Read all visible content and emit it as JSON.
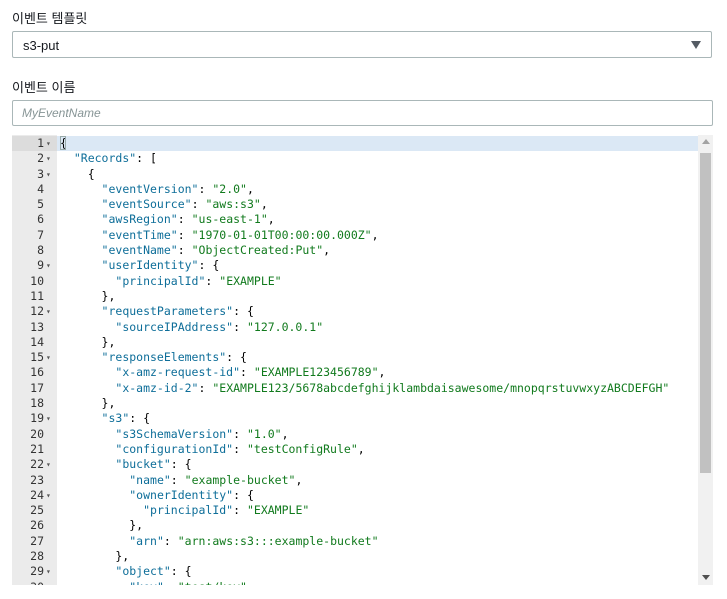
{
  "template_field": {
    "label": "이벤트 템플릿",
    "selected": "s3-put"
  },
  "name_field": {
    "label": "이벤트 이름",
    "placeholder": "MyEventName",
    "value": ""
  },
  "editor": {
    "lines": [
      {
        "n": "1",
        "fold": true,
        "text": "{"
      },
      {
        "n": "2",
        "fold": true,
        "text": "  \"Records\": ["
      },
      {
        "n": "3",
        "fold": true,
        "text": "    {"
      },
      {
        "n": "4",
        "fold": false,
        "text": "      \"eventVersion\": \"2.0\","
      },
      {
        "n": "5",
        "fold": false,
        "text": "      \"eventSource\": \"aws:s3\","
      },
      {
        "n": "6",
        "fold": false,
        "text": "      \"awsRegion\": \"us-east-1\","
      },
      {
        "n": "7",
        "fold": false,
        "text": "      \"eventTime\": \"1970-01-01T00:00:00.000Z\","
      },
      {
        "n": "8",
        "fold": false,
        "text": "      \"eventName\": \"ObjectCreated:Put\","
      },
      {
        "n": "9",
        "fold": true,
        "text": "      \"userIdentity\": {"
      },
      {
        "n": "10",
        "fold": false,
        "text": "        \"principalId\": \"EXAMPLE\""
      },
      {
        "n": "11",
        "fold": false,
        "text": "      },"
      },
      {
        "n": "12",
        "fold": true,
        "text": "      \"requestParameters\": {"
      },
      {
        "n": "13",
        "fold": false,
        "text": "        \"sourceIPAddress\": \"127.0.0.1\""
      },
      {
        "n": "14",
        "fold": false,
        "text": "      },"
      },
      {
        "n": "15",
        "fold": true,
        "text": "      \"responseElements\": {"
      },
      {
        "n": "16",
        "fold": false,
        "text": "        \"x-amz-request-id\": \"EXAMPLE123456789\","
      },
      {
        "n": "17",
        "fold": false,
        "text": "        \"x-amz-id-2\": \"EXAMPLE123/5678abcdefghijklambdaisawesome/mnopqrstuvwxyzABCDEFGH\""
      },
      {
        "n": "18",
        "fold": false,
        "text": "      },"
      },
      {
        "n": "19",
        "fold": true,
        "text": "      \"s3\": {"
      },
      {
        "n": "20",
        "fold": false,
        "text": "        \"s3SchemaVersion\": \"1.0\","
      },
      {
        "n": "21",
        "fold": false,
        "text": "        \"configurationId\": \"testConfigRule\","
      },
      {
        "n": "22",
        "fold": true,
        "text": "        \"bucket\": {"
      },
      {
        "n": "23",
        "fold": false,
        "text": "          \"name\": \"example-bucket\","
      },
      {
        "n": "24",
        "fold": true,
        "text": "          \"ownerIdentity\": {"
      },
      {
        "n": "25",
        "fold": false,
        "text": "            \"principalId\": \"EXAMPLE\""
      },
      {
        "n": "26",
        "fold": false,
        "text": "          },"
      },
      {
        "n": "27",
        "fold": false,
        "text": "          \"arn\": \"arn:aws:s3:::example-bucket\""
      },
      {
        "n": "28",
        "fold": false,
        "text": "        },"
      },
      {
        "n": "29",
        "fold": true,
        "text": "        \"object\": {"
      },
      {
        "n": "30",
        "fold": false,
        "text": "          \"key\": \"test/key\","
      }
    ]
  },
  "icons": {
    "select_caret": "chevron-down-icon",
    "fold_marker": "fold-triangle-icon",
    "scroll_up": "scroll-up-arrow-icon",
    "scroll_down": "scroll-down-arrow-icon"
  },
  "colors": {
    "json_key": "#0e6e99",
    "json_string": "#117a1d",
    "gutter_bg": "#ebebeb",
    "active_line": "#dbe8f5",
    "border": "#aab7b8"
  }
}
